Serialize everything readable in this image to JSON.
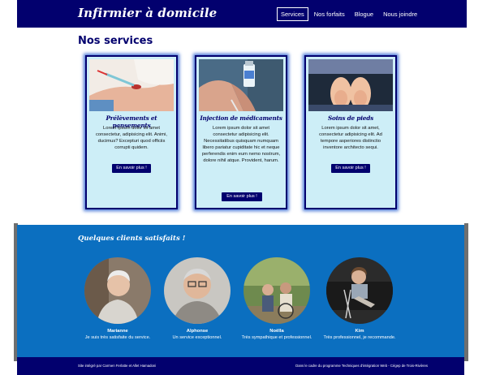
{
  "header": {
    "brand": "Infirmier à domicile",
    "nav": [
      {
        "label": "Services",
        "active": true
      },
      {
        "label": "Nos forfaits",
        "active": false
      },
      {
        "label": "Blogue",
        "active": false
      },
      {
        "label": "Nous joindre",
        "active": false
      }
    ]
  },
  "services": {
    "title": "Nos services",
    "cards": [
      {
        "title": "Prélèvements et pansements",
        "text": "Lorem ipsum dolor sit amet consectetur, adipisicing elit. Animi, ducimus? Excepturi quod officiis corrupti quidem.",
        "button": "En savoir plus !",
        "image": "blood-draw-photo"
      },
      {
        "title": "Injection de médicaments",
        "text": "Lorem ipsum dolor sit amet consectetur adipisicing elit. Necessitatibus quisquam numquam libero pariatur cupiditate hic et neque perferendis enim eum nemo nostrum, dolore nihil atque. Provident, harum.",
        "button": "En savoir plus !",
        "image": "medication-vial-photo"
      },
      {
        "title": "Soins de pieds",
        "text": "Lorem ipsum dolor sit amet, consectetur adipisicing elit. Ad tempore asperiores distinctio inventore architecto sequi.",
        "button": "En savoir plus !",
        "image": "feet-photo"
      }
    ]
  },
  "clients": {
    "title": "Quelques clients satisfaits !",
    "items": [
      {
        "name": "Marianne",
        "quote": "Je suis très satisfaite du service."
      },
      {
        "name": "Alphonse",
        "quote": "Un service exceptionnel."
      },
      {
        "name": "Noëlla",
        "quote": "Très sympathique et professionnel."
      },
      {
        "name": "Kim",
        "quote": "Très professionnel, je recommande."
      }
    ]
  },
  "footer": {
    "left": "Site intégré par Carmen Ferlatte et Allet Hamadoni",
    "right": "Dans le cadre du programme Techniques d'intégration Web - Cégep de Trois-Rivières"
  },
  "colors": {
    "navy": "#02006e",
    "card_bg": "#cdeef7",
    "clients_bg": "#0b6fc0"
  }
}
